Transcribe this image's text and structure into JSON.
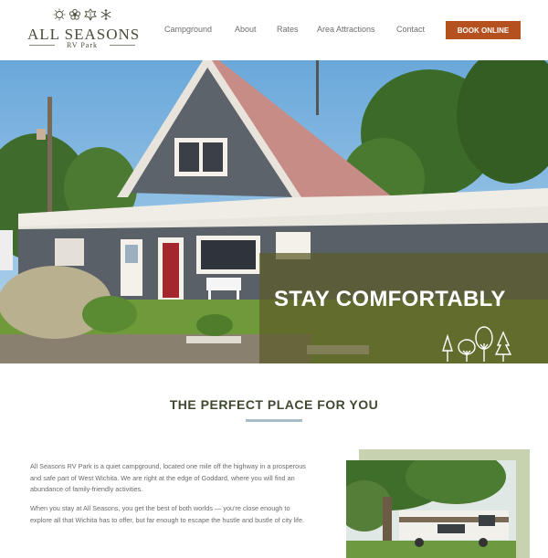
{
  "header": {
    "logo": {
      "title": "ALL SEASONS",
      "subtitle": "RV Park",
      "icons": [
        "sun-icon",
        "flower-icon",
        "leaf-icon",
        "snowflake-icon"
      ]
    },
    "nav": [
      {
        "label": "Campground"
      },
      {
        "label": "About"
      },
      {
        "label": "Rates"
      },
      {
        "label": "Area Attractions"
      },
      {
        "label": "Contact"
      }
    ],
    "book_label": "BOOK ONLINE"
  },
  "hero": {
    "headline": "STAY COMFORTABLY"
  },
  "section": {
    "title": "THE PERFECT PLACE FOR YOU",
    "paragraph1": "All Seasons RV Park is a quiet campground, located one mile off the highway in a prosperous and safe part of West Wichita. We are right at the edge of Goddard, where you will find an abundance of family-friendly activities.",
    "paragraph2": "When you stay at All Seasons, you get the best of both worlds — you're close enough to explore all that Wichita has to offer, but far enough to escape the hustle and bustle of city life."
  },
  "colors": {
    "accent": "#b5501f",
    "overlay": "#5c5a28",
    "heading": "#3f4a30",
    "frame": "#c6d2b0"
  }
}
